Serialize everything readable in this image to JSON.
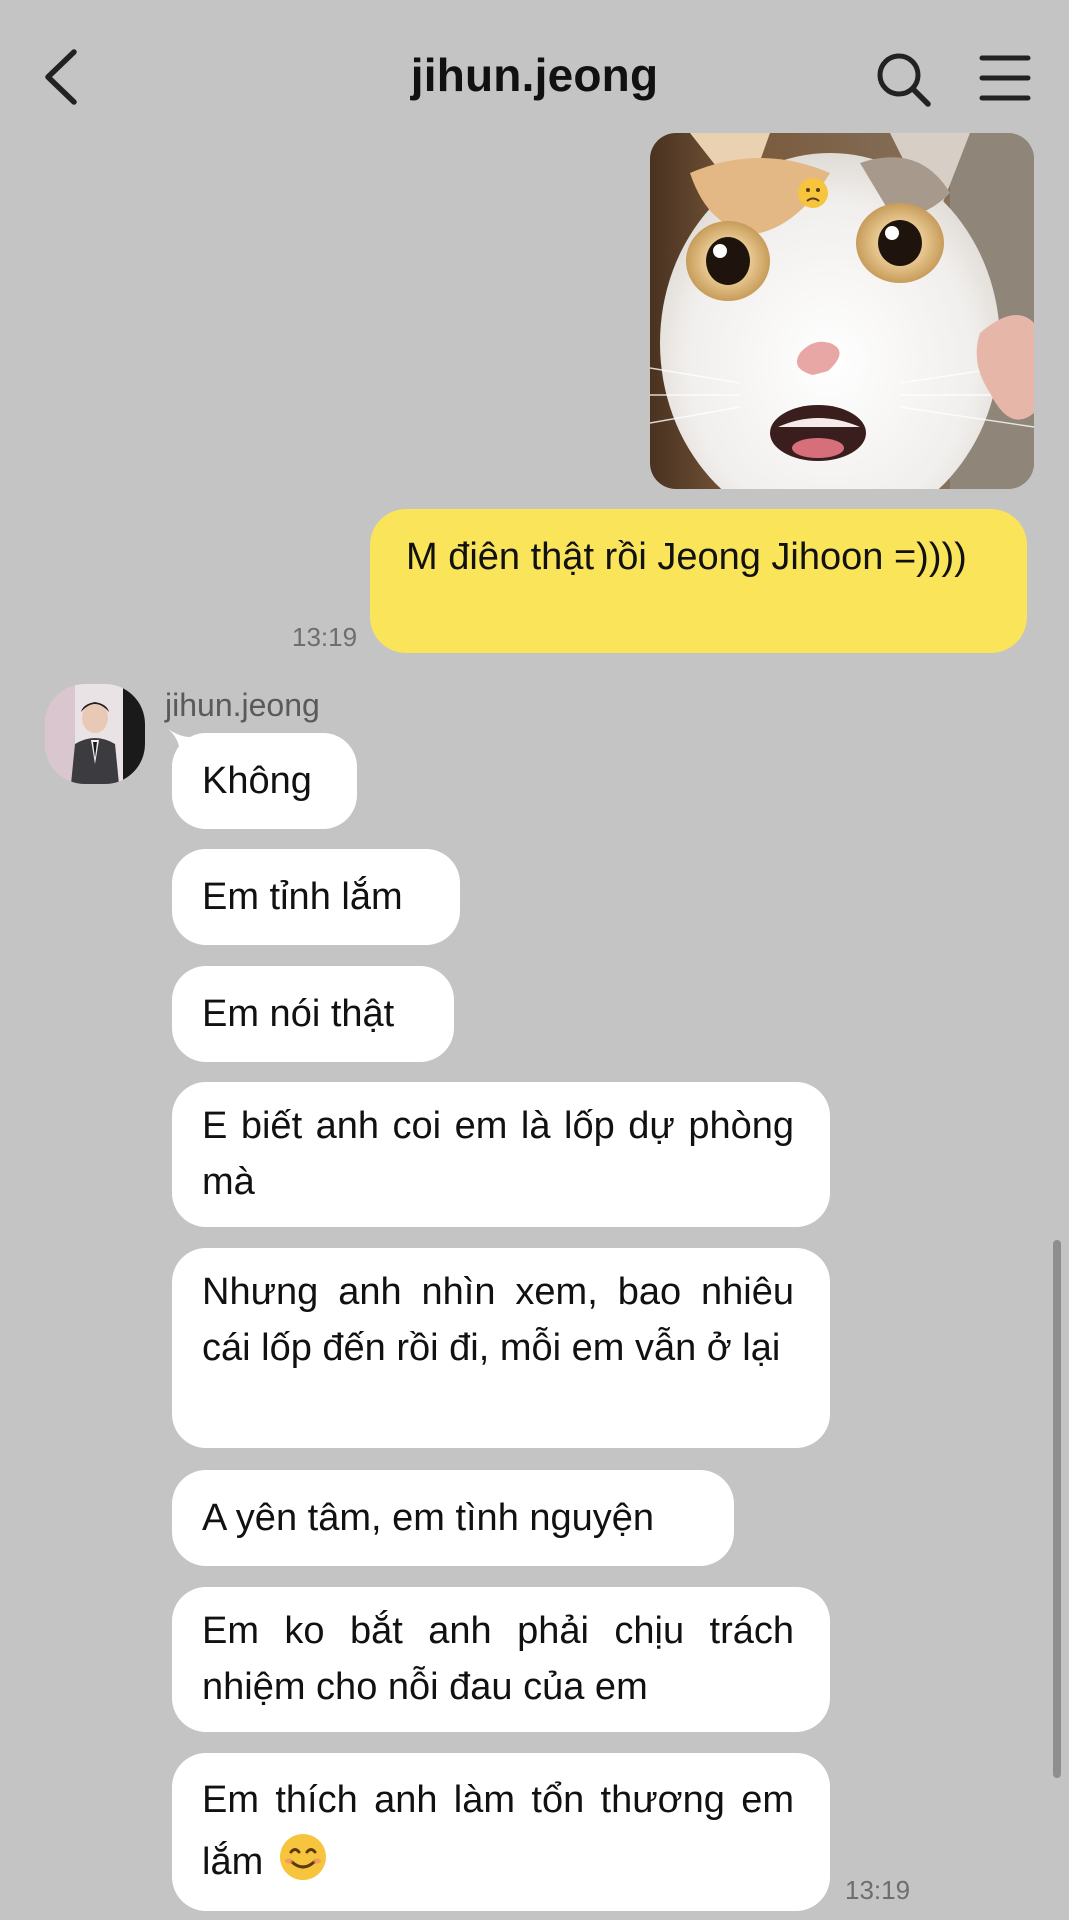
{
  "header": {
    "title": "jihun.jeong",
    "back_icon": "chevron-left-icon",
    "search_icon": "search-icon",
    "menu_icon": "hamburger-menu-icon"
  },
  "sent": {
    "photo_description_icon": "cat-photo",
    "message": "M điên thật rồi Jeong Jihoon =))))",
    "time": "13:19",
    "bubble_color": "#f9e45a"
  },
  "received": {
    "sender_name": "jihun.jeong",
    "messages": [
      "Không",
      "Em tỉnh lắm",
      "Em nói thật",
      "E biết anh coi em là lốp dự phòng mà",
      "Nhưng anh nhìn xem, bao nhiêu cái lốp đến rồi đi, mỗi em vẫn ở lại",
      "A yên tâm, em tình nguyện",
      "Em ko bắt anh phải chịu trách nhiệm cho nỗi đau của em",
      "Em thích anh làm tổn thương em lắm"
    ],
    "last_emoji": "smiling-face-icon",
    "time": "13:19"
  },
  "colors": {
    "background": "#c4c4c4",
    "received_bubble": "#ffffff",
    "sent_bubble": "#f9e45a",
    "timestamp": "#6e6e6e"
  }
}
